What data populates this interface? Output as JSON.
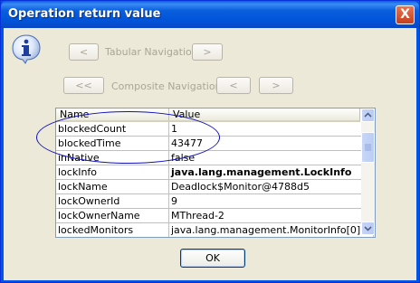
{
  "window": {
    "title": "Operation return value",
    "close_label": "X"
  },
  "nav": {
    "tabular_label": "Tabular Navigation",
    "composite_label": "Composite Navigation",
    "prev": "<",
    "next": ">",
    "first": "<<"
  },
  "table": {
    "columns": [
      "Name",
      "Value"
    ],
    "rows": [
      {
        "name": "blockedCount",
        "value": "1"
      },
      {
        "name": "blockedTime",
        "value": "43477"
      },
      {
        "name": "inNative",
        "value": "false"
      },
      {
        "name": "lockInfo",
        "value": "java.lang.management.LockInfo"
      },
      {
        "name": "lockName",
        "value": "Deadlock$Monitor@4788d5"
      },
      {
        "name": "lockOwnerId",
        "value": "9"
      },
      {
        "name": "lockOwnerName",
        "value": "MThread-2"
      },
      {
        "name": "lockedMonitors",
        "value": "java.lang.management.MonitorInfo[0]"
      }
    ]
  },
  "ok_label": "OK",
  "icons": {
    "info": "info-icon",
    "close": "close-icon"
  }
}
